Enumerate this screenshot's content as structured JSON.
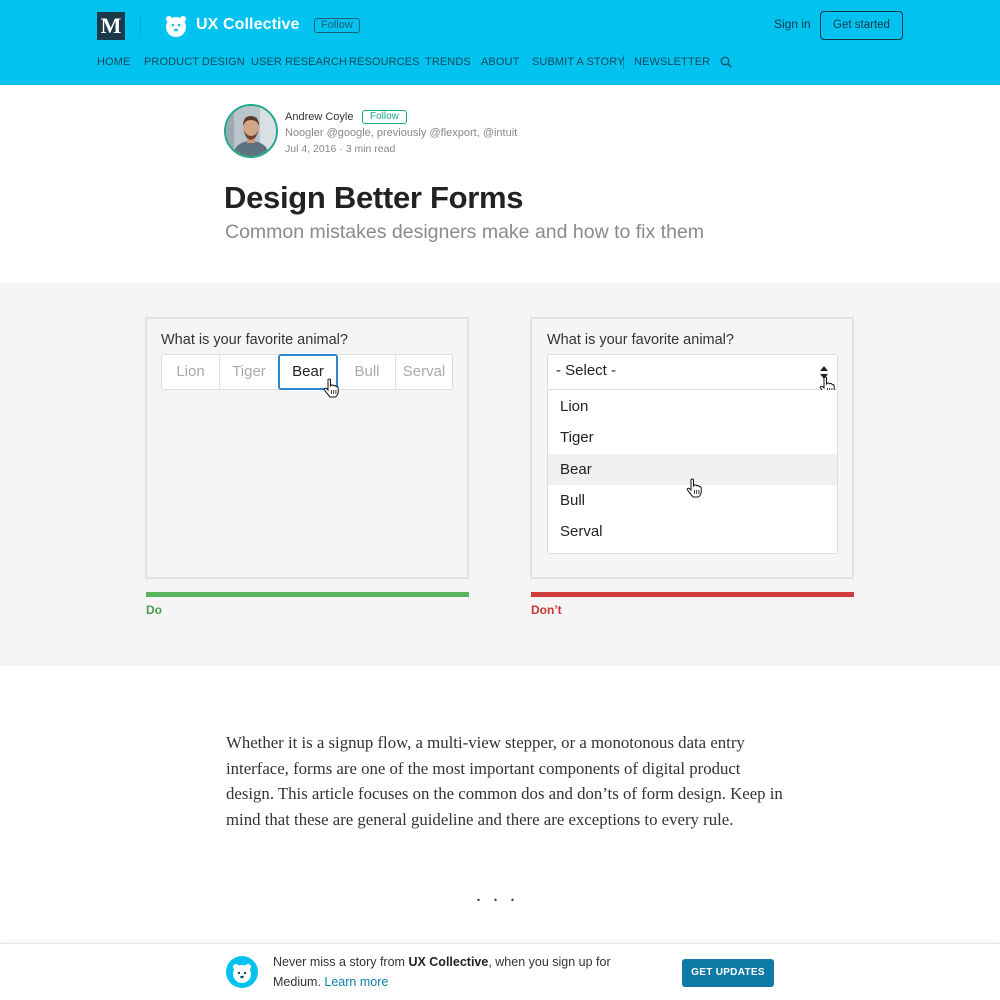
{
  "header": {
    "logo_letter": "M",
    "publication_name": "UX Collective",
    "follow_label": "Follow",
    "signin_label": "Sign in",
    "get_started_label": "Get started",
    "bg_color": "#02c2f0",
    "nav": [
      "HOME",
      "PRODUCT DESIGN",
      "USER RESEARCH",
      "RESOURCES",
      "TRENDS",
      "ABOUT",
      "SUBMIT A STORY",
      "NEWSLETTER"
    ]
  },
  "author": {
    "name": "Andrew Coyle",
    "follow_label": "Follow",
    "bio": "Noogler @google, previously @flexport, @intuit",
    "meta": "Jul 4, 2016 · 3 min read"
  },
  "article": {
    "title": "Design Better Forms",
    "subtitle": "Common mistakes designers make and how to fix them",
    "paragraph": "Whether it is a signup flow, a multi-view stepper, or a monotonous data entry interface, forms are one of the most important components of digital product design. This article focuses on the common dos and don’ts of form design. Keep in mind that these are general guideline and there are exceptions to every rule.",
    "separator": "..."
  },
  "figure": {
    "left": {
      "question": "What is your favorite animal?",
      "options": [
        "Lion",
        "Tiger",
        "Bear",
        "Bull",
        "Serval"
      ],
      "selected": "Bear",
      "caption": "Do",
      "caption_color": "#59b55a"
    },
    "right": {
      "question": "What is your favorite animal?",
      "placeholder": "- Select -",
      "options": [
        "Lion",
        "Tiger",
        "Bear",
        "Bull",
        "Serval"
      ],
      "highlighted": "Bear",
      "caption": "Don’t",
      "caption_color": "#d23b3b"
    }
  },
  "footer": {
    "text_prefix": "Never miss a story from ",
    "publication": "UX Collective",
    "text_suffix": ", when you sign up for Medium. ",
    "learn_more": "Learn more",
    "cta_label": "GET UPDATES"
  }
}
